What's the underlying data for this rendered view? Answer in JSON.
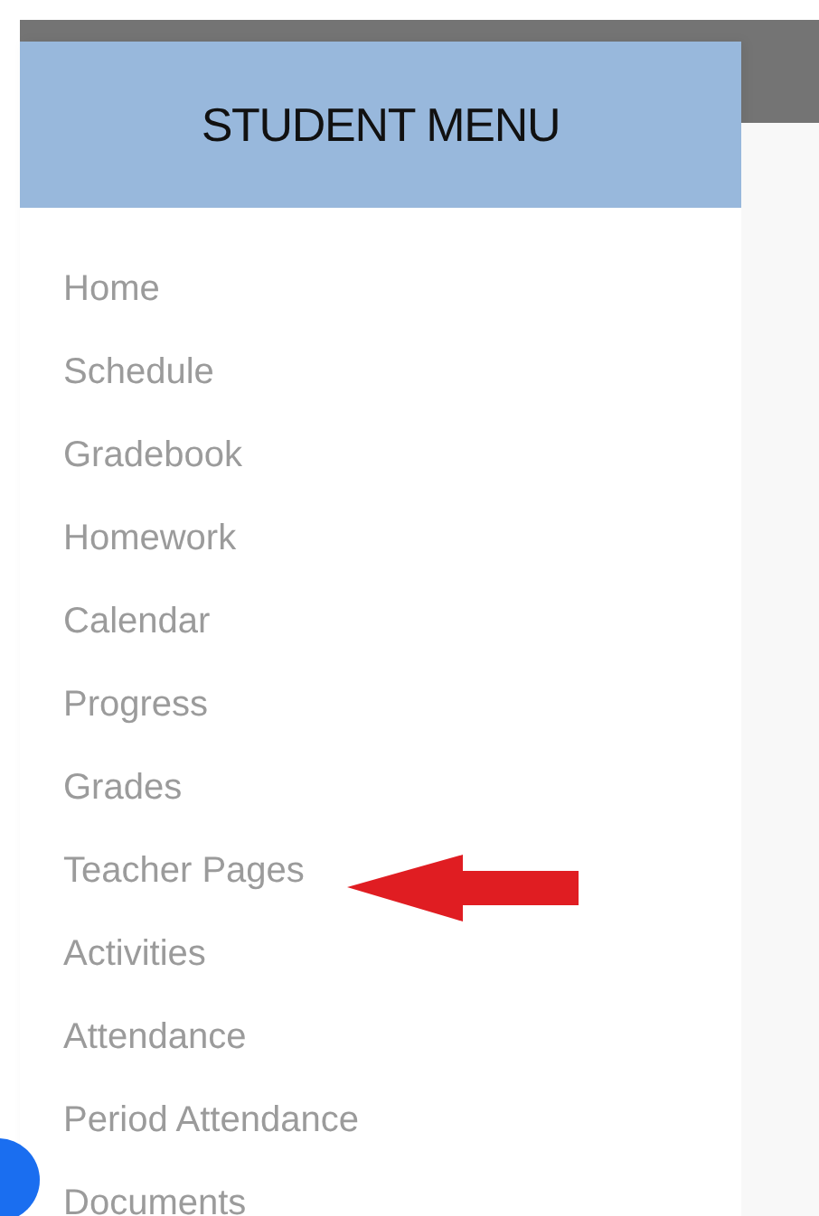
{
  "menu": {
    "title": "STUDENT MENU",
    "items": [
      {
        "label": "Home"
      },
      {
        "label": "Schedule"
      },
      {
        "label": "Gradebook"
      },
      {
        "label": "Homework"
      },
      {
        "label": "Calendar"
      },
      {
        "label": "Progress"
      },
      {
        "label": "Grades"
      },
      {
        "label": "Teacher Pages",
        "pointed": true
      },
      {
        "label": "Activities"
      },
      {
        "label": "Attendance"
      },
      {
        "label": "Period Attendance"
      },
      {
        "label": "Documents"
      }
    ]
  }
}
